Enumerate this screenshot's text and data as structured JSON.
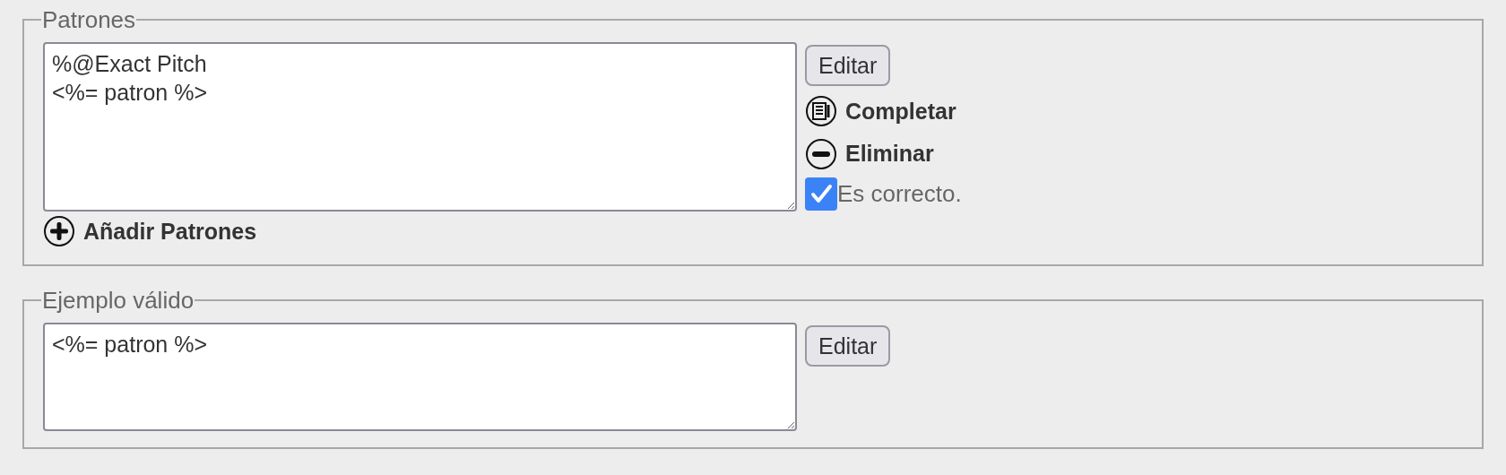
{
  "sections": [
    {
      "legend": "Patrones",
      "text": "%@Exact Pitch\n<%= patron %>",
      "edit_button": "Editar",
      "actions": [
        {
          "kind": "complete",
          "label": "Completar"
        },
        {
          "kind": "remove",
          "label": "Eliminar"
        }
      ],
      "checkbox": {
        "label": "Es correcto.",
        "checked": true
      },
      "add_link": "Añadir Patrones"
    },
    {
      "legend": "Ejemplo válido",
      "text": "<%= patron %>",
      "edit_button": "Editar"
    }
  ]
}
